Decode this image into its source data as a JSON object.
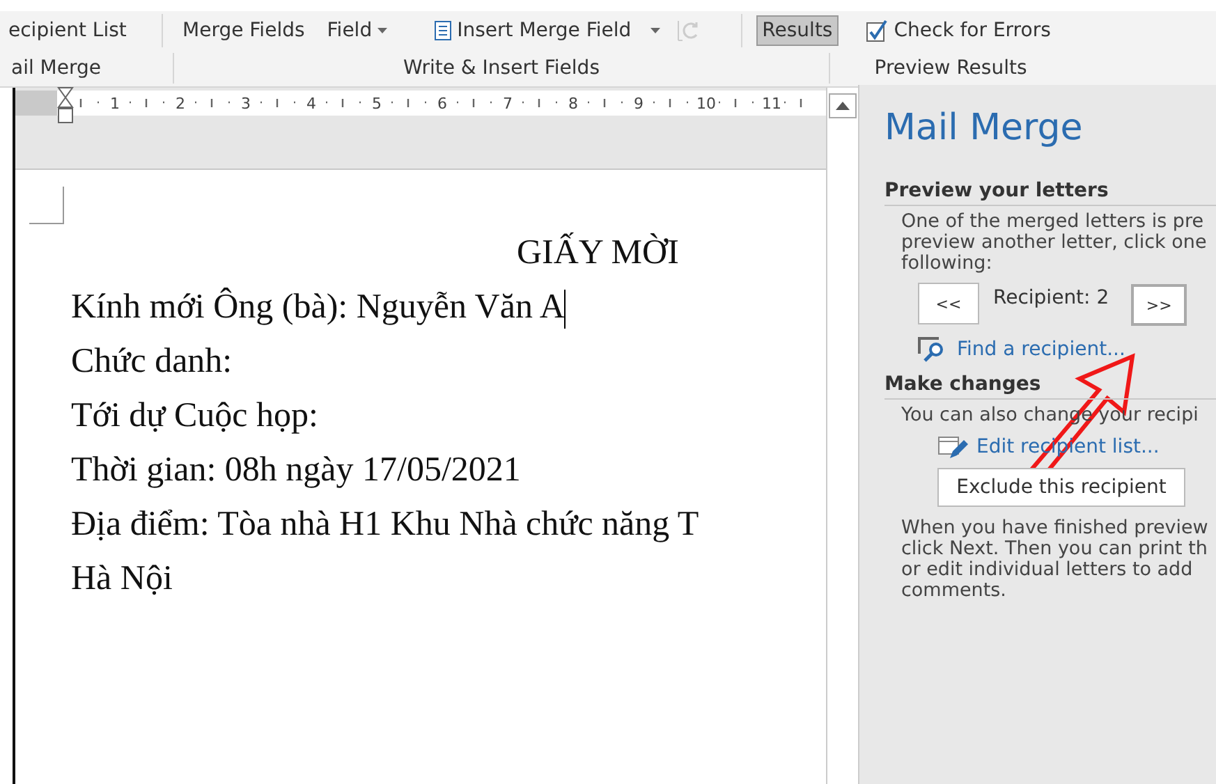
{
  "ribbon": {
    "commands": [
      {
        "kind": "text",
        "label": "ecipient List"
      },
      {
        "kind": "sep"
      },
      {
        "kind": "text",
        "label": "Merge Fields"
      },
      {
        "kind": "dropdown",
        "label": "Field"
      },
      {
        "kind": "insert",
        "label": "Insert Merge Field"
      },
      {
        "kind": "refresh"
      },
      {
        "kind": "sep"
      },
      {
        "kind": "toggle",
        "label": "Results",
        "selected": true
      },
      {
        "kind": "check",
        "label": "Check for Errors"
      }
    ],
    "groups": [
      "ail Merge",
      "Write & Insert Fields",
      "Preview Results"
    ]
  },
  "ruler": [
    "1",
    "2",
    "3",
    "4",
    "5",
    "6",
    "7",
    "8",
    "9",
    "10",
    "11"
  ],
  "document": {
    "title": "GIẤY MỜI",
    "lines": [
      "Kính mới Ông (bà): Nguyễn Văn A",
      "Chức danh:",
      "Tới dự Cuộc họp:",
      "Thời gian: 08h ngày 17/05/2021",
      "Địa điểm: Tòa nhà H1 Khu Nhà chức năng T",
      "Hà Nội"
    ]
  },
  "pane": {
    "title": "Mail Merge",
    "preview_heading": "Preview your letters",
    "preview_text": [
      "One of the merged letters is pre",
      "preview another letter, click one",
      "following:"
    ],
    "prev_button": "<<",
    "recipient": "Recipient: 2",
    "next_button": ">>",
    "find_link": "Find a recipient...",
    "changes_heading": "Make changes",
    "changes_text": "You can also change your recipi",
    "edit_link": "Edit recipient list...",
    "exclude_button": "Exclude this recipient",
    "finish_text": [
      "When you have finished preview",
      "click Next. Then you can print th",
      "or edit individual letters to add",
      "comments."
    ]
  }
}
